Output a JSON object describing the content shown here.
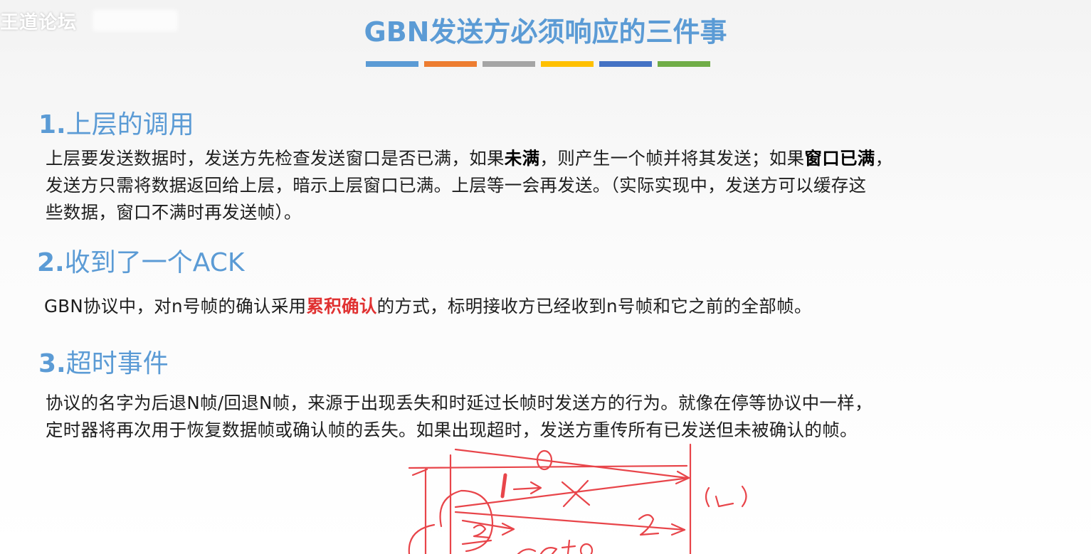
{
  "watermark": {
    "text": "王道论坛"
  },
  "title": "GBN发送方必须响应的三件事",
  "color_bar": [
    "#5b9bd5",
    "#ed7d31",
    "#a5a5a5",
    "#ffc000",
    "#4472c4",
    "#70ad47"
  ],
  "sections": [
    {
      "number": "1.",
      "heading": "上层的调用",
      "lines": [
        {
          "pre": "上层要发送数据时，发送方先检查发送窗口是否已满，如果",
          "b1": "未满",
          "mid": "，则产生一个帧并将其发送；如果",
          "b2": "窗口已满",
          "post": "，"
        },
        "发送方只需将数据返回给上层，暗示上层窗口已满。上层等一会再发送。（实际实现中，发送方可以缓存这",
        "些数据，窗口不满时再发送帧）。"
      ]
    },
    {
      "number": "2.",
      "heading": "收到了一个ACK",
      "pre": "GBN协议中，对n号帧的确认采用",
      "highlight": "累积确认",
      "post": "的方式，标明接收方已经收到n号帧和它之前的全部帧。"
    },
    {
      "number": "3.",
      "heading": "超时事件",
      "lines": [
        "协议的名字为后退N帧/回退N帧，来源于出现丢失和时延过长帧时发送方的行为。就像在停等协议中一样，",
        "定时器将再次用于恢复数据帧或确认帧的丢失。如果出现超时，发送方重传所有已发送但未被确认的帧。"
      ]
    }
  ],
  "annotation": {
    "color": "#e8454a",
    "labels": [
      "0",
      "1",
      "2",
      "(1)"
    ]
  }
}
